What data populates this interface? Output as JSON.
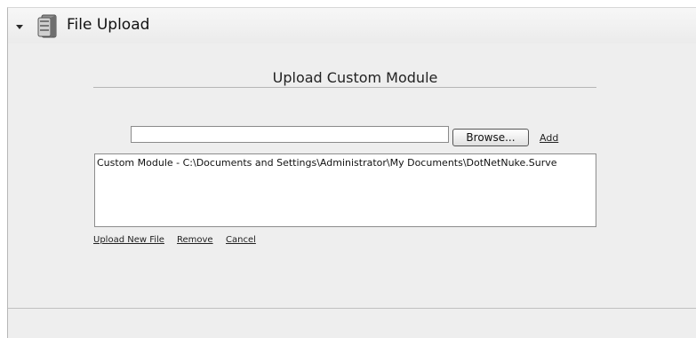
{
  "module": {
    "title": "File Upload",
    "icon": "file-upload-icon"
  },
  "upload": {
    "heading": "Upload Custom Module",
    "file_input_value": "",
    "browse_label": "Browse...",
    "add_label": "Add",
    "files": [
      "Custom Module - C:\\Documents and Settings\\Administrator\\My Documents\\DotNetNuke.Surve"
    ]
  },
  "actions": {
    "upload_new_file": "Upload New File",
    "remove": "Remove",
    "cancel": "Cancel"
  }
}
